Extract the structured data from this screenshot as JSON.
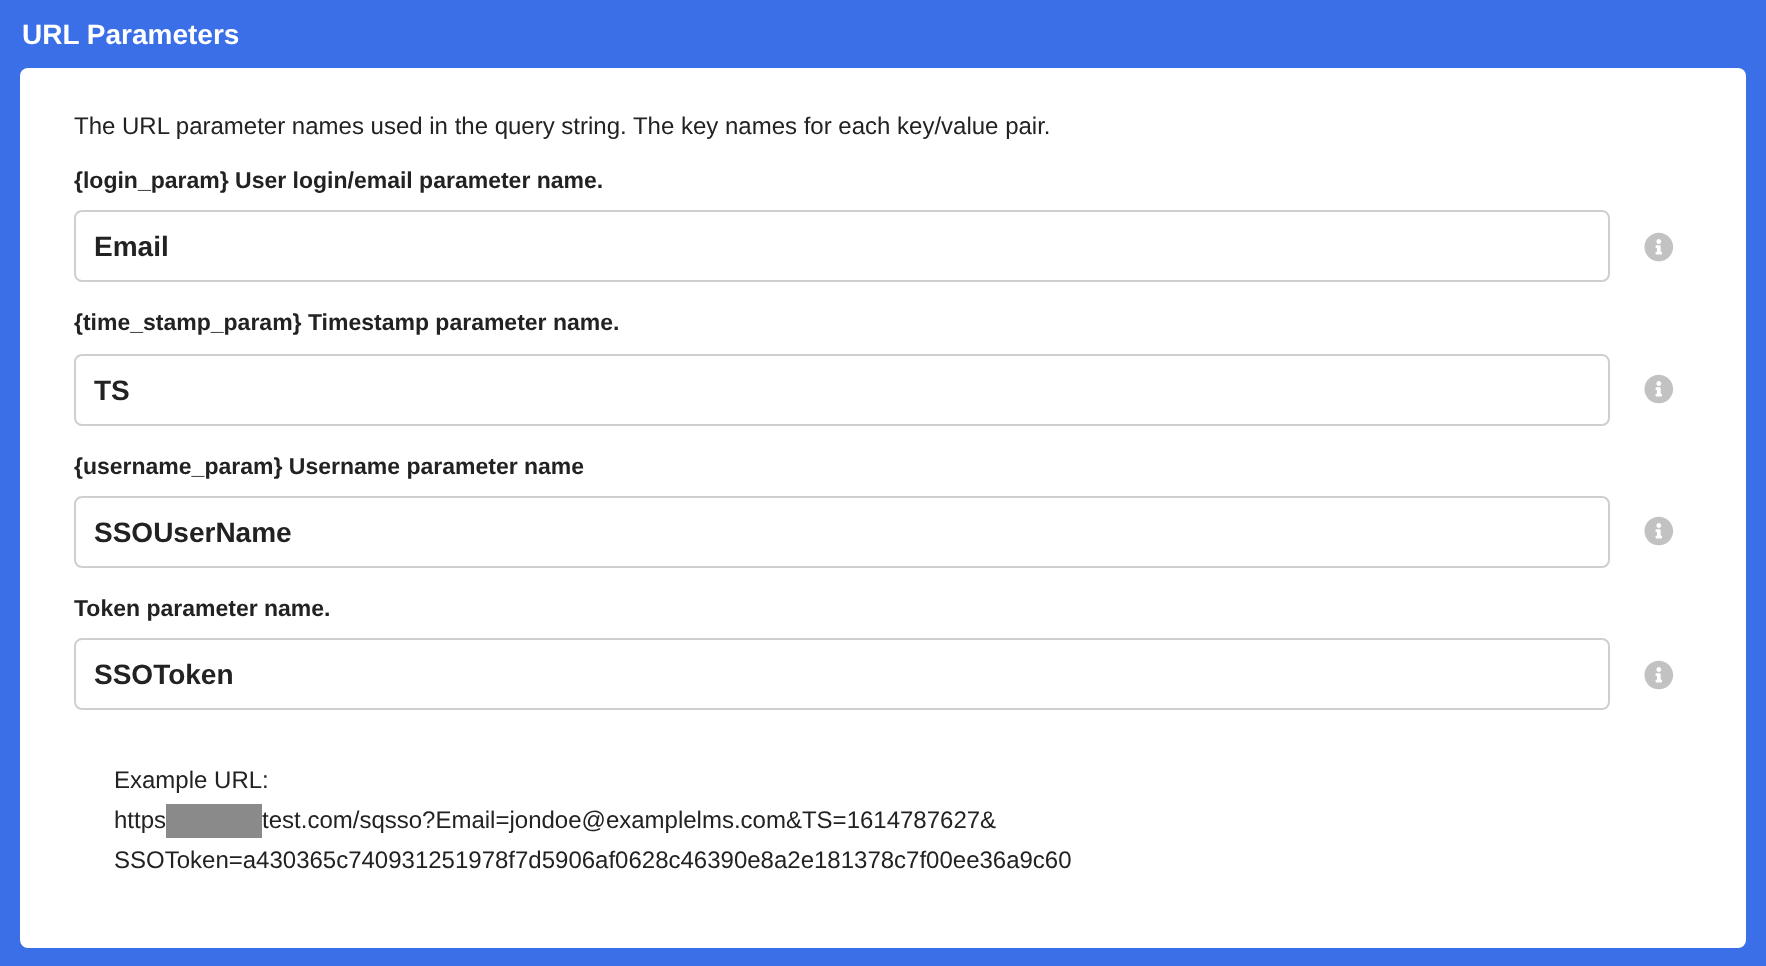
{
  "header": {
    "title": "URL Parameters"
  },
  "description": "The URL parameter names used in the query string. The key names for each key/value pair.",
  "fields": [
    {
      "label": "{login_param} User login/email parameter name.",
      "value": "Email"
    },
    {
      "label": "{time_stamp_param} Timestamp parameter name.",
      "value": "TS"
    },
    {
      "label": "{username_param} Username parameter name",
      "value": "SSOUserName"
    },
    {
      "label": "Token parameter name.",
      "value": "SSOToken"
    }
  ],
  "example": {
    "label": "Example URL:",
    "url_start": "https",
    "url_rest": "test.com/sqsso?Email=jondoe@examplelms.com&TS=1614787627&",
    "url_line2": "SSOToken=a430365c740931251978f7d5906af0628c46390e8a2e181378c7f00ee36a9c60"
  }
}
